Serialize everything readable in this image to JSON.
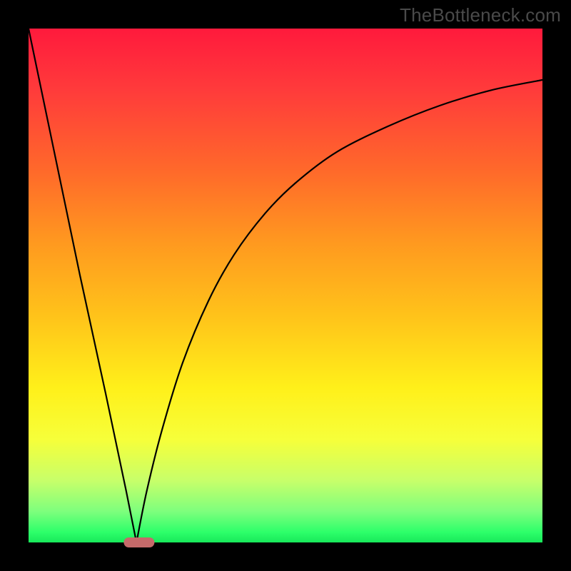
{
  "watermark": "TheBottleneck.com",
  "chart_data": {
    "type": "line",
    "title": "",
    "xlabel": "",
    "ylabel": "",
    "xlim": [
      0,
      100
    ],
    "ylim": [
      0,
      100
    ],
    "grid": false,
    "series": [
      {
        "name": "left-branch",
        "x": [
          0,
          5,
          10,
          15,
          19,
          21
        ],
        "values": [
          100,
          76,
          52,
          29,
          10,
          0
        ]
      },
      {
        "name": "right-branch",
        "x": [
          21,
          23,
          26,
          30,
          35,
          40,
          46,
          52,
          60,
          70,
          80,
          90,
          100
        ],
        "values": [
          0,
          10,
          22,
          35,
          47,
          56,
          64,
          70,
          76,
          81,
          85,
          88,
          90
        ]
      }
    ],
    "marker": {
      "x": 21.5,
      "y": 0,
      "width_pct": 6,
      "color": "#c56a6a"
    },
    "background_gradient": [
      {
        "stop": 0.0,
        "color": "#ff1a3c"
      },
      {
        "stop": 0.28,
        "color": "#ff6a2a"
      },
      {
        "stop": 0.56,
        "color": "#ffc31a"
      },
      {
        "stop": 0.8,
        "color": "#f6ff3a"
      },
      {
        "stop": 0.94,
        "color": "#7dff7d"
      },
      {
        "stop": 1.0,
        "color": "#18e85a"
      }
    ]
  },
  "colors": {
    "frame": "#000000",
    "curve": "#000000",
    "watermark": "#4a4a4a",
    "marker": "#c56a6a"
  }
}
